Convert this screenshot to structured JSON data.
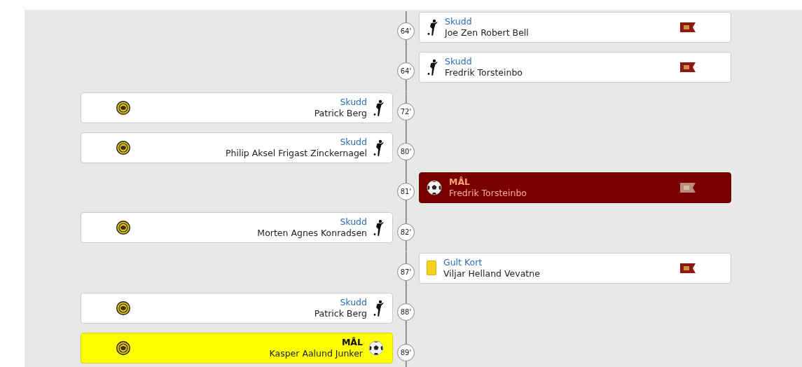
{
  "events": [
    {
      "away": true,
      "kind": "shot",
      "minute": "64'",
      "title": "Skudd",
      "player": "Joe Zen Robert Bell"
    },
    {
      "away": true,
      "kind": "shot",
      "minute": "64'",
      "title": "Skudd",
      "player": "Fredrik Torsteinbo"
    },
    {
      "away": false,
      "kind": "shot",
      "minute": "72'",
      "title": "Skudd",
      "player": "Patrick Berg"
    },
    {
      "away": false,
      "kind": "shot",
      "minute": "80'",
      "title": "Skudd",
      "player": "Philip Aksel Frigast Zinckernagel"
    },
    {
      "away": true,
      "kind": "goal",
      "minute": "81'",
      "title": "MÅL",
      "player": "Fredrik Torsteinbo"
    },
    {
      "away": false,
      "kind": "shot",
      "minute": "82'",
      "title": "Skudd",
      "player": "Morten Agnes Konradsen"
    },
    {
      "away": true,
      "kind": "booking",
      "minute": "87'",
      "title": "Gult Kort",
      "player": "Viljar Helland Vevatne"
    },
    {
      "away": false,
      "kind": "shot",
      "minute": "88'",
      "title": "Skudd",
      "player": "Patrick Berg"
    },
    {
      "away": false,
      "kind": "goal",
      "minute": "89'",
      "title": "MÅL",
      "player": "Kasper Aalund Junker"
    }
  ]
}
